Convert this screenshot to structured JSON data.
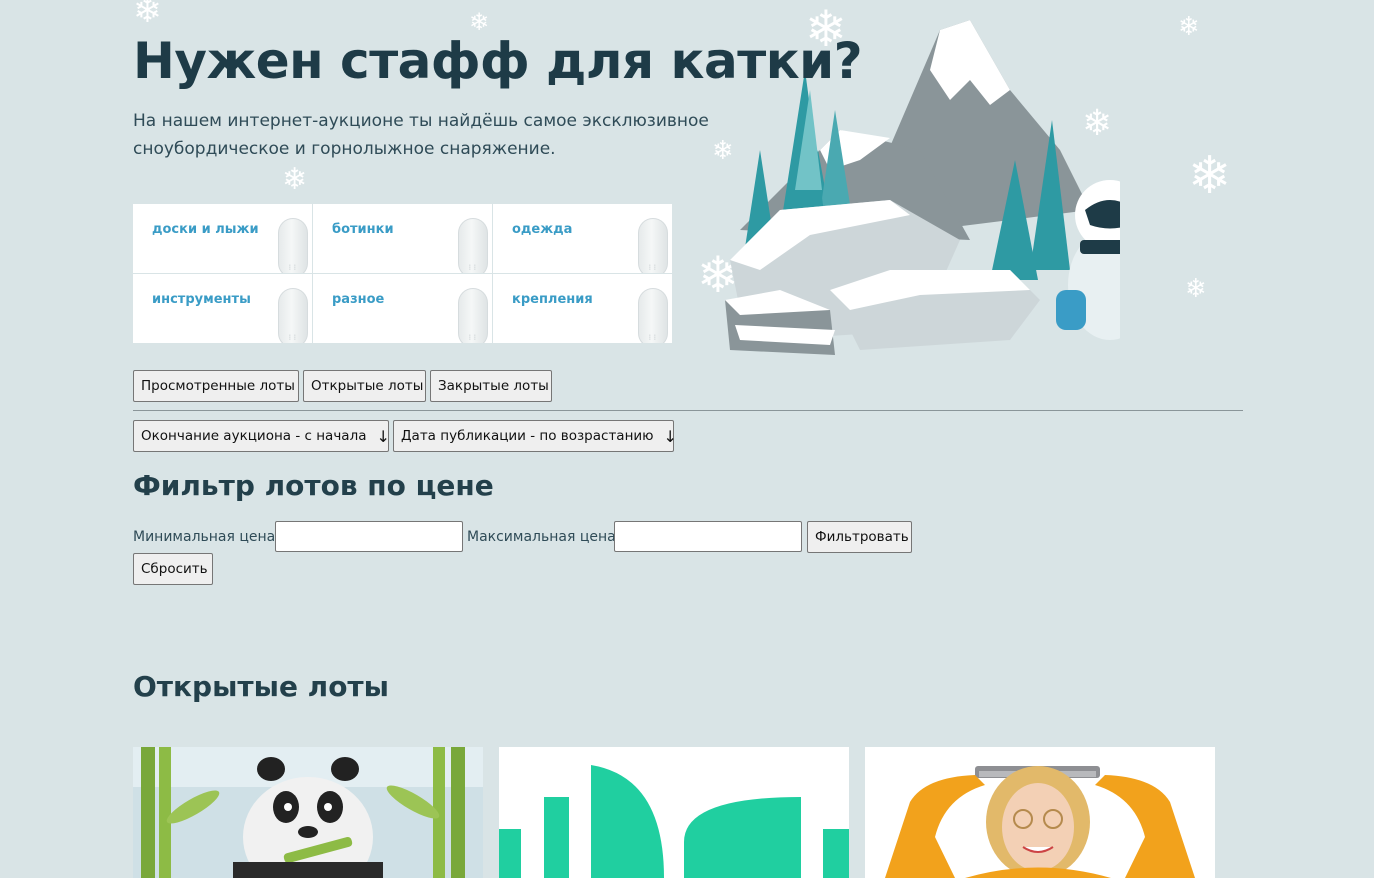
{
  "hero": {
    "title": "Нужен стафф для катки?",
    "text_line1": "На нашем интернет-аукционе ты найдёшь самое эксклюзивное",
    "text_line2": "сноубордическое и горнолыжное снаряжение."
  },
  "categories": [
    {
      "label": "доски и лыжи"
    },
    {
      "label": "ботинки"
    },
    {
      "label": "одежда"
    },
    {
      "label": "инструменты"
    },
    {
      "label": "разное"
    },
    {
      "label": "крепления"
    }
  ],
  "tabs": {
    "viewed": "Просмотренные лоты",
    "open": "Открытые лоты",
    "closed": "Закрытые лоты"
  },
  "sort": {
    "end_label": "Окончание аукциона - с начала",
    "pub_label": "Дата публикации - по возрастанию",
    "arrow": "↓"
  },
  "filter": {
    "title": "Фильтр лотов по цене",
    "min_label": "Минимальная цена:",
    "max_label": "Максимальная цена:",
    "apply": "Фильтровать",
    "reset": "Сбросить"
  },
  "lots_section": {
    "title": "Открытые лоты"
  },
  "colors": {
    "background": "#d9e4e6",
    "accent_link": "#3a9cc6",
    "teal": "#20cfa0"
  }
}
